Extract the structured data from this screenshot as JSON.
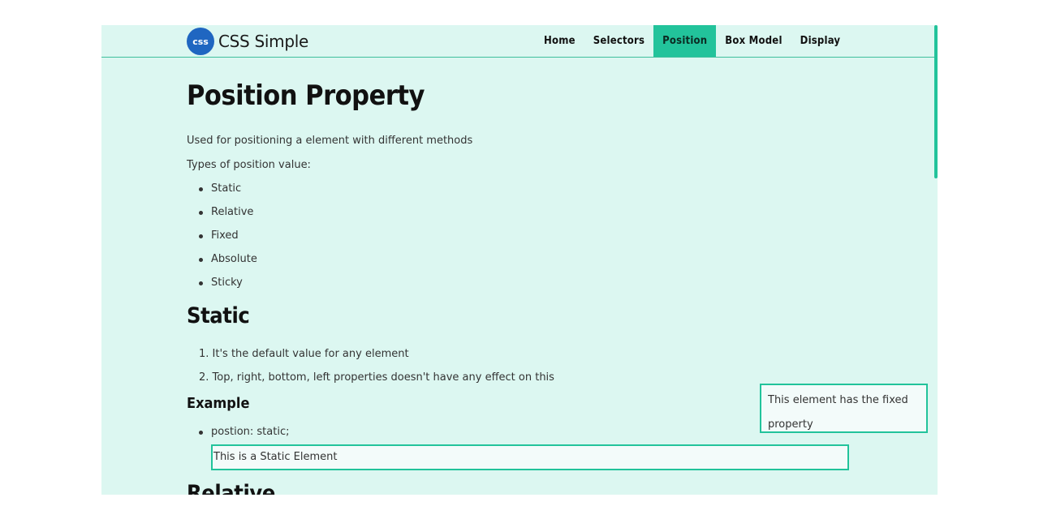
{
  "brand": {
    "badge": "css",
    "name": "CSS Simple"
  },
  "nav": {
    "items": [
      {
        "label": "Home",
        "active": false
      },
      {
        "label": "Selectors",
        "active": false
      },
      {
        "label": "Position",
        "active": true
      },
      {
        "label": "Box Model",
        "active": false
      },
      {
        "label": "Display",
        "active": false
      }
    ]
  },
  "page": {
    "title": "Position Property",
    "intro": "Used for positioning a element with different methods",
    "types_label": "Types of position value:",
    "types": [
      "Static",
      "Relative",
      "Fixed",
      "Absolute",
      "Sticky"
    ]
  },
  "static_section": {
    "heading": "Static",
    "points": [
      "1. It's the default value for any element",
      "2. Top, right, bottom, left properties doesn't have any effect on this"
    ],
    "example_heading": "Example",
    "example_item": "postion: static;",
    "demo_text": "This is a Static Element"
  },
  "next_section": {
    "heading": "Relative"
  },
  "fixed_element": {
    "text": "This element has the fixed property"
  },
  "colors": {
    "accent": "#22c39b",
    "background": "#dcf7f1",
    "brand_badge": "#1f66c1"
  }
}
